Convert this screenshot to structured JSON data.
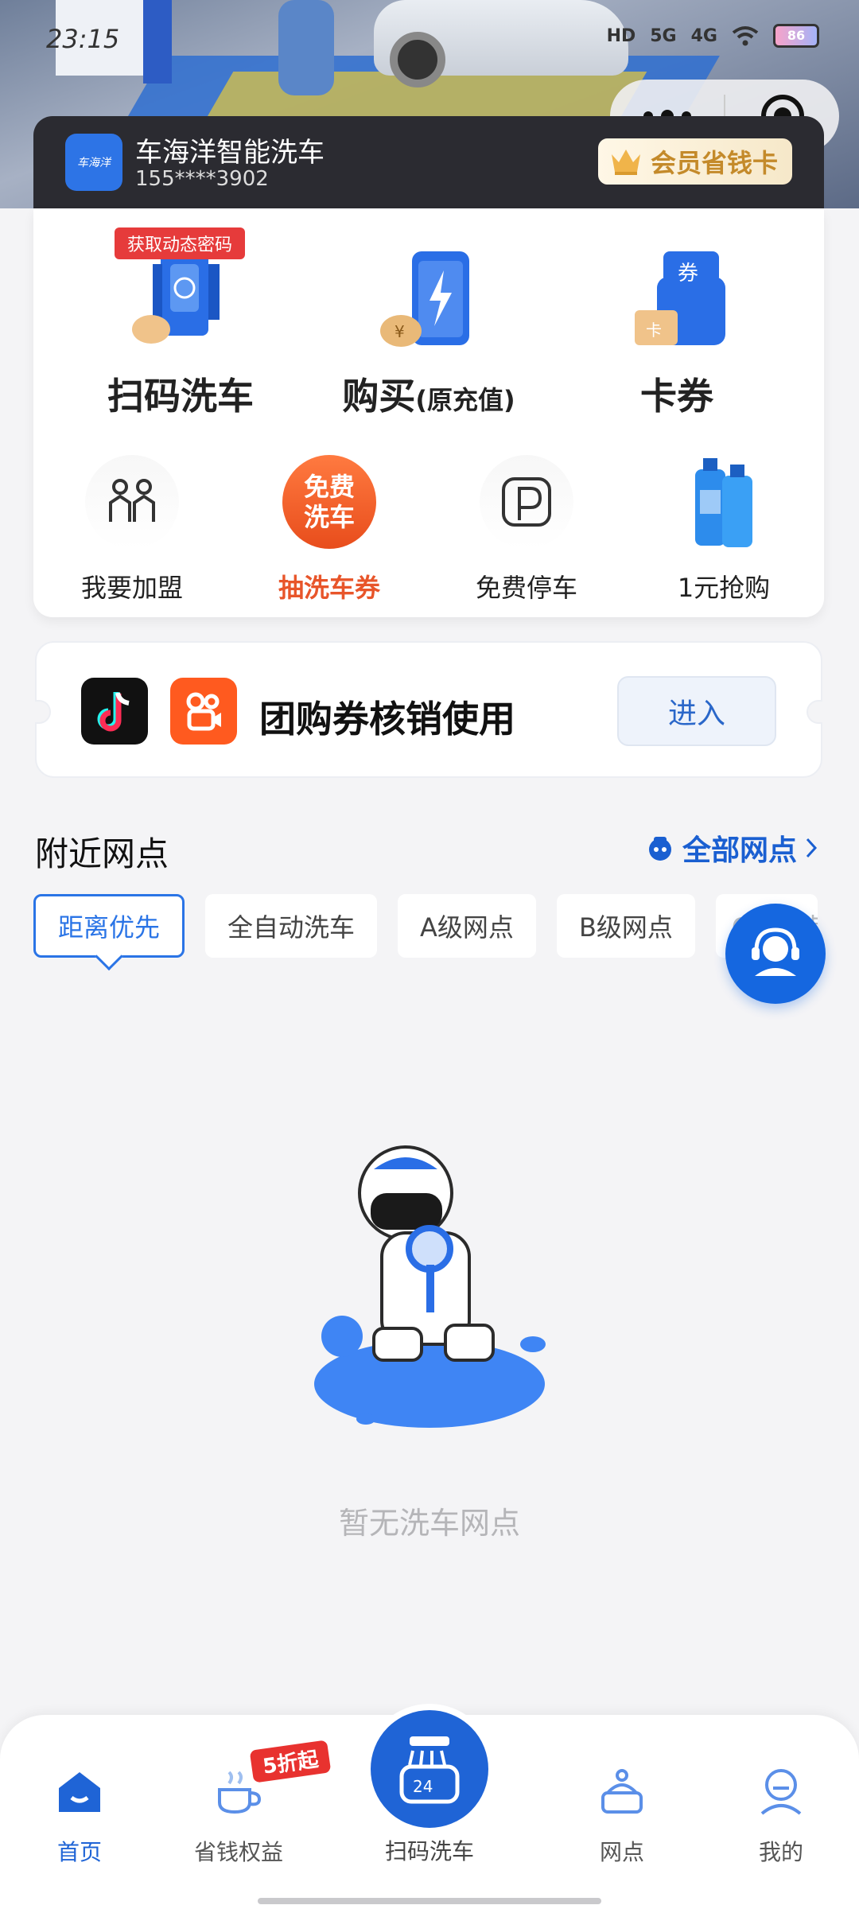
{
  "status_bar": {
    "time": "23:15",
    "network": [
      "HD",
      "5G",
      "4G"
    ],
    "battery": "86"
  },
  "header": {
    "brand_name": "车海洋智能洗车",
    "phone": "155****3902",
    "logo_text": "车海洋",
    "vip_label": "会员省钱卡"
  },
  "main_functions": [
    {
      "label": "扫码洗车",
      "tag": "获取动态密码",
      "icon": "scan-wash-icon"
    },
    {
      "label": "购买",
      "sub": "(原充值)",
      "icon": "recharge-phone-icon"
    },
    {
      "label": "卡券",
      "icon": "coupon-wallet-icon"
    }
  ],
  "small_functions": [
    {
      "label": "我要加盟",
      "icon": "franchise-icon"
    },
    {
      "label": "抽洗车券",
      "icon": "free-wash-icon",
      "icon_text": "免费洗车",
      "highlight": true
    },
    {
      "label": "免费停车",
      "icon": "parking-icon"
    },
    {
      "label": "1元抢购",
      "icon": "washer-fluid-icon"
    }
  ],
  "group_buy": {
    "title": "团购券核销使用",
    "button": "进入"
  },
  "nearby": {
    "title": "附近网点",
    "all_link": "全部网点",
    "filters": [
      "距离优先",
      "全自动洗车",
      "A级网点",
      "B级网点",
      "C级网点"
    ],
    "active_filter": 0,
    "empty_text": "暂无洗车网点"
  },
  "tabbar": {
    "items": [
      {
        "label": "首页",
        "icon": "home-icon",
        "active": true
      },
      {
        "label": "省钱权益",
        "icon": "coffee-cup-icon",
        "badge": "5折起"
      },
      {
        "label": "扫码洗车",
        "icon": "scan-wash-icon",
        "center": true
      },
      {
        "label": "网点",
        "icon": "station-icon"
      },
      {
        "label": "我的",
        "icon": "profile-icon"
      }
    ]
  },
  "colors": {
    "primary": "#1f64d6",
    "accent_red": "#e63b3b",
    "dark_bar": "#2b2b31",
    "vip_gold": "#c48a2a"
  }
}
